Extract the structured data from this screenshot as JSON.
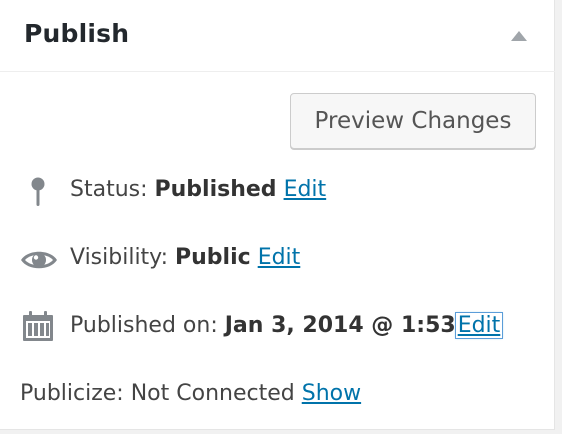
{
  "publish_box": {
    "title": "Publish",
    "preview_button_label": "Preview Changes",
    "status": {
      "label": "Status:",
      "value": "Published",
      "edit_label": "Edit"
    },
    "visibility": {
      "label": "Visibility:",
      "value": "Public",
      "edit_label": "Edit"
    },
    "published_on": {
      "label": "Published on:",
      "value": "Jan 3, 2014 @ 1:53",
      "edit_label": "Edit"
    },
    "publicize": {
      "label": "Publicize:",
      "value": "Not Connected",
      "show_label": "Show"
    }
  },
  "colors": {
    "link": "#0073aa",
    "icon": "#82878c",
    "focus_ring": "#5b9dd9"
  },
  "icons": {
    "status": "pin-icon",
    "visibility": "eye-icon",
    "published_on": "calendar-icon",
    "toggle": "collapse-arrow-icon"
  }
}
